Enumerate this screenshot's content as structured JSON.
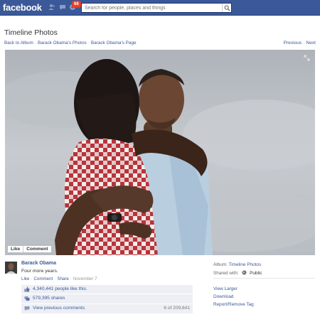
{
  "topbar": {
    "logo": "facebook",
    "notifications_count": "68",
    "search_placeholder": "Search for people, places and things"
  },
  "header": {
    "title": "Timeline Photos",
    "breadcrumbs": [
      "Back to Album",
      "Barack Obama's Photos",
      "Barack Obama's Page"
    ],
    "previous": "Previous",
    "next": "Next"
  },
  "photo": {
    "like": "Like",
    "comment": "Comment"
  },
  "post": {
    "author": "Barack Obama",
    "caption": "Four more years.",
    "actions": [
      "Like",
      "Comment",
      "Share"
    ],
    "date": "November 7",
    "likes_count": "4,340,441",
    "likes_text": "people like this.",
    "shares": "579,395 shares",
    "view_previous": "View previous comments",
    "comments_position": "6 of 209,641"
  },
  "sidebar": {
    "album_label": "Album:",
    "album_name": "Timeline Photos",
    "shared_label": "Shared with:",
    "shared_value": "Public",
    "view_larger": "View Larger",
    "download": "Download",
    "report": "Report/Remove Tag"
  },
  "colors": {
    "brand": "#3b5998",
    "badge": "#f03d25",
    "ufi_background": "#edeff4"
  },
  "icons": [
    "friend-requests-icon",
    "messages-icon",
    "notifications-icon",
    "search-icon",
    "expand-icon",
    "thumbs-up-icon",
    "share-icon",
    "comment-icon",
    "globe-icon"
  ]
}
